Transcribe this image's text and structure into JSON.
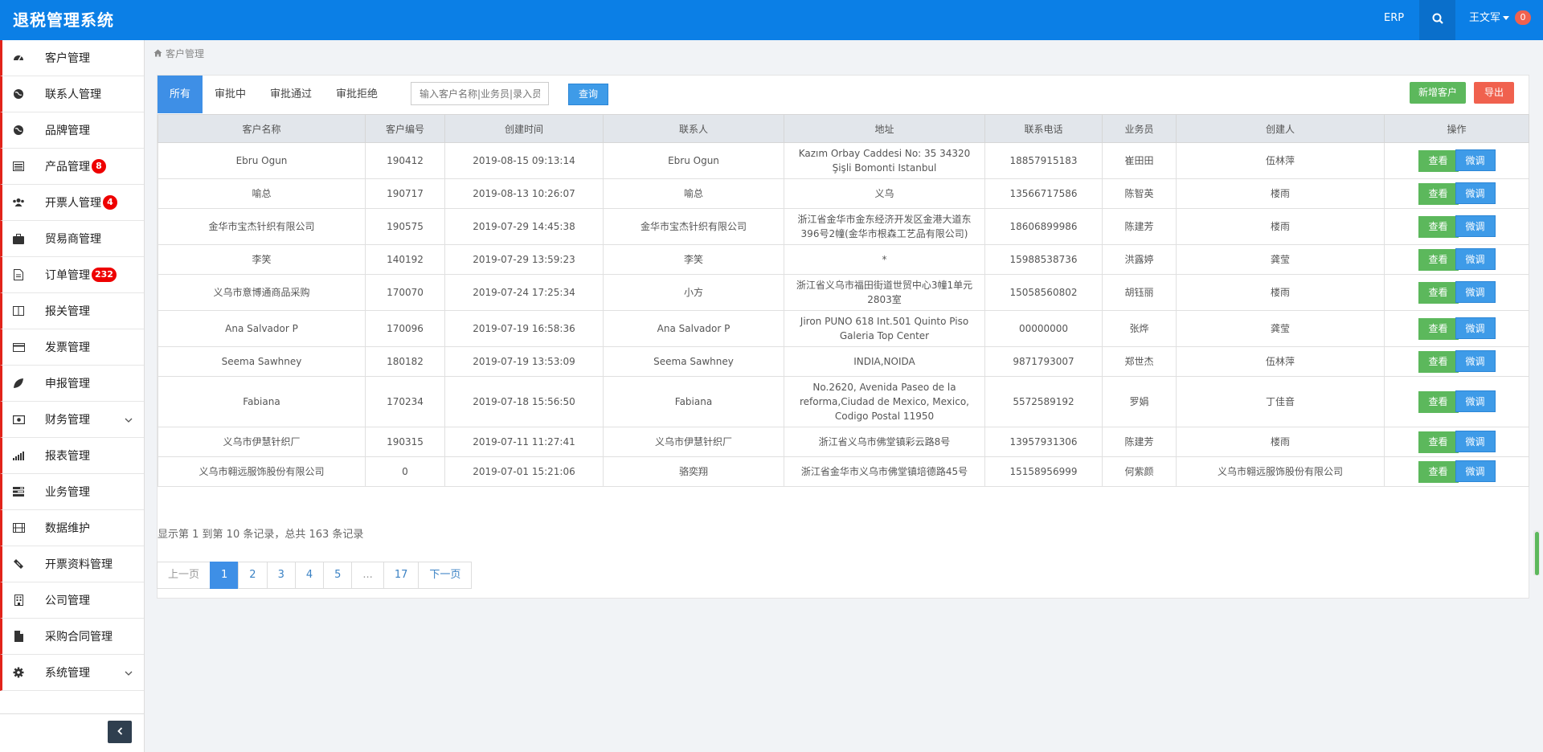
{
  "header": {
    "title": "退税管理系统",
    "erp_label": "ERP",
    "user_name": "王文军",
    "notification_count": "0",
    "brand_color": "#0b7fe6"
  },
  "sidebar": {
    "items": [
      {
        "label": "客户管理",
        "icon": "dashboard-icon"
      },
      {
        "label": "联系人管理",
        "icon": "globe-icon"
      },
      {
        "label": "品牌管理",
        "icon": "globe-icon"
      },
      {
        "label": "产品管理",
        "icon": "list-icon",
        "count": "8"
      },
      {
        "label": "开票人管理",
        "icon": "users-icon",
        "count": "4"
      },
      {
        "label": "贸易商管理",
        "icon": "briefcase-icon"
      },
      {
        "label": "订单管理",
        "icon": "document-icon",
        "count": "232"
      },
      {
        "label": "报关管理",
        "icon": "columns-icon"
      },
      {
        "label": "发票管理",
        "icon": "credit-card-icon"
      },
      {
        "label": "申报管理",
        "icon": "leaf-icon"
      },
      {
        "label": "财务管理",
        "icon": "money-icon",
        "expandable": true
      },
      {
        "label": "报表管理",
        "icon": "signal-icon"
      },
      {
        "label": "业务管理",
        "icon": "tasks-icon"
      },
      {
        "label": "数据维护",
        "icon": "film-icon"
      },
      {
        "label": "开票资料管理",
        "icon": "ticket-icon"
      },
      {
        "label": "公司管理",
        "icon": "building-icon"
      },
      {
        "label": "采购合同管理",
        "icon": "file-icon"
      },
      {
        "label": "系统管理",
        "icon": "cog-icon",
        "expandable": true
      }
    ]
  },
  "breadcrumb": "客户管理",
  "toolbar": {
    "tabs": [
      "所有",
      "审批中",
      "审批通过",
      "审批拒绝"
    ],
    "active_tab": "所有",
    "search_placeholder": "输入客户名称|业务员|录入员",
    "query_label": "查询",
    "add_label": "新增客户",
    "export_label": "导出"
  },
  "table": {
    "columns": [
      "客户名称",
      "客户编号",
      "创建时间",
      "联系人",
      "地址",
      "联系电话",
      "业务员",
      "创建人",
      "操作"
    ],
    "view_label": "查看",
    "tune_label": "微调",
    "rows": [
      {
        "name": "Ebru Ogun",
        "code": "190412",
        "created": "2019-08-15 09:13:14",
        "contact": "Ebru Ogun",
        "address": "Kazım Orbay Caddesi No: 35 34320 Şişli Bomonti Istanbul",
        "phone": "18857915183",
        "sales": "崔田田",
        "creator": "伍林萍"
      },
      {
        "name": "喻总",
        "code": "190717",
        "created": "2019-08-13 10:26:07",
        "contact": "喻总",
        "address": "义乌",
        "phone": "13566717586",
        "sales": "陈智英",
        "creator": "楼雨"
      },
      {
        "name": "金华市宝杰针织有限公司",
        "code": "190575",
        "created": "2019-07-29 14:45:38",
        "contact": "金华市宝杰针织有限公司",
        "address": "浙江省金华市金东经济开发区金港大道东396号2幢(金华市根森工艺品有限公司)",
        "phone": "18606899986",
        "sales": "陈建芳",
        "creator": "楼雨"
      },
      {
        "name": "李笑",
        "code": "140192",
        "created": "2019-07-29 13:59:23",
        "contact": "李笑",
        "address": "*",
        "phone": "15988538736",
        "sales": "洪露婷",
        "creator": "龚莹"
      },
      {
        "name": "义乌市意博通商品采购",
        "code": "170070",
        "created": "2019-07-24 17:25:34",
        "contact": "小方",
        "address": "浙江省义乌市福田街道世贸中心3幢1单元2803室",
        "phone": "15058560802",
        "sales": "胡钰丽",
        "creator": "楼雨"
      },
      {
        "name": "Ana Salvador P",
        "code": "170096",
        "created": "2019-07-19 16:58:36",
        "contact": "Ana Salvador P",
        "address": "Jiron PUNO 618 Int.501 Quinto Piso Galeria Top Center",
        "phone": "00000000",
        "sales": "张烨",
        "creator": "龚莹"
      },
      {
        "name": "Seema Sawhney",
        "code": "180182",
        "created": "2019-07-19 13:53:09",
        "contact": "Seema Sawhney",
        "address": "INDIA,NOIDA",
        "phone": "9871793007",
        "sales": "郑世杰",
        "creator": "伍林萍"
      },
      {
        "name": "Fabiana",
        "code": "170234",
        "created": "2019-07-18 15:56:50",
        "contact": "Fabiana",
        "address": "No.2620, Avenida Paseo de la reforma,Ciudad de Mexico, Mexico, Codigo Postal 11950",
        "phone": "5572589192",
        "sales": "罗娟",
        "creator": "丁佳音"
      },
      {
        "name": "义乌市伊慧针织厂",
        "code": "190315",
        "created": "2019-07-11 11:27:41",
        "contact": "义乌市伊慧针织厂",
        "address": "浙江省义乌市佛堂镇彩云路8号",
        "phone": "13957931306",
        "sales": "陈建芳",
        "creator": "楼雨"
      },
      {
        "name": "义乌市翱远服饰股份有限公司",
        "code": "0",
        "created": "2019-07-01 15:21:06",
        "contact": "骆奕翔",
        "address": "浙江省金华市义乌市佛堂镇培德路45号",
        "phone": "15158956999",
        "sales": "何紫颜",
        "creator": "义乌市翱远服饰股份有限公司"
      }
    ]
  },
  "summary": "显示第 1 到第 10 条记录，总共 163 条记录",
  "pagination": {
    "prev": "上一页",
    "next": "下一页",
    "pages": [
      "1",
      "2",
      "3",
      "4",
      "5",
      "...",
      "17"
    ],
    "active": "1"
  }
}
